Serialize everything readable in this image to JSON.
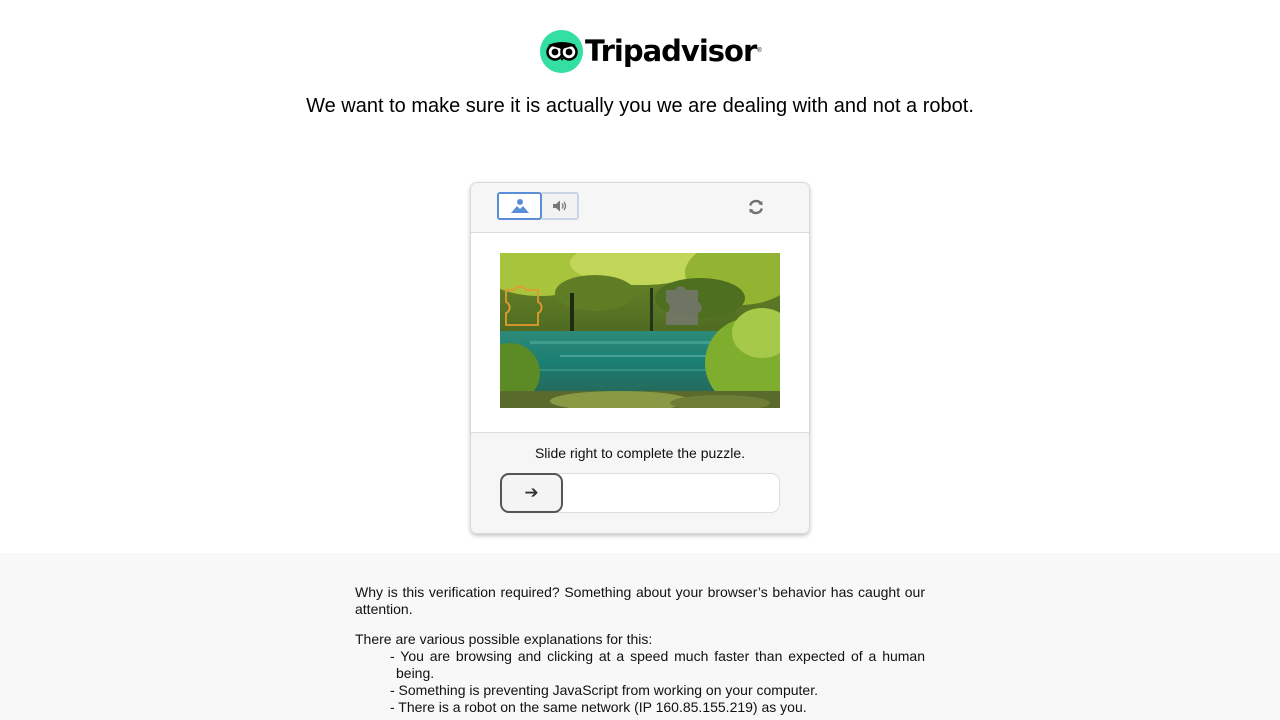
{
  "brand": {
    "name": "Tripadvisor",
    "registered_mark": "®",
    "logo_color": "#34e0a1"
  },
  "headline": "We want to make sure it is actually you we are dealing with and not a robot.",
  "captcha": {
    "modes": [
      {
        "name": "image",
        "icon": "image-icon",
        "selected": true
      },
      {
        "name": "audio",
        "icon": "speaker-icon",
        "selected": false
      }
    ],
    "refresh_icon": "refresh-icon",
    "instruction": "Slide right to complete the puzzle.",
    "slider_icon": "➔",
    "slider_progress": 0,
    "accent_color": "#5b8ed6"
  },
  "info": {
    "why": "Why is this verification required? Something about your browser’s behavior has caught our attention.",
    "explanations_intro": "There are various possible explanations for this:",
    "reasons": [
      "- You are browsing and clicking at a speed much faster than expected of a human being.",
      "- Something is preventing JavaScript from working on your computer.",
      "- There is a robot on the same network (IP 160.85.155.219) as you."
    ]
  }
}
